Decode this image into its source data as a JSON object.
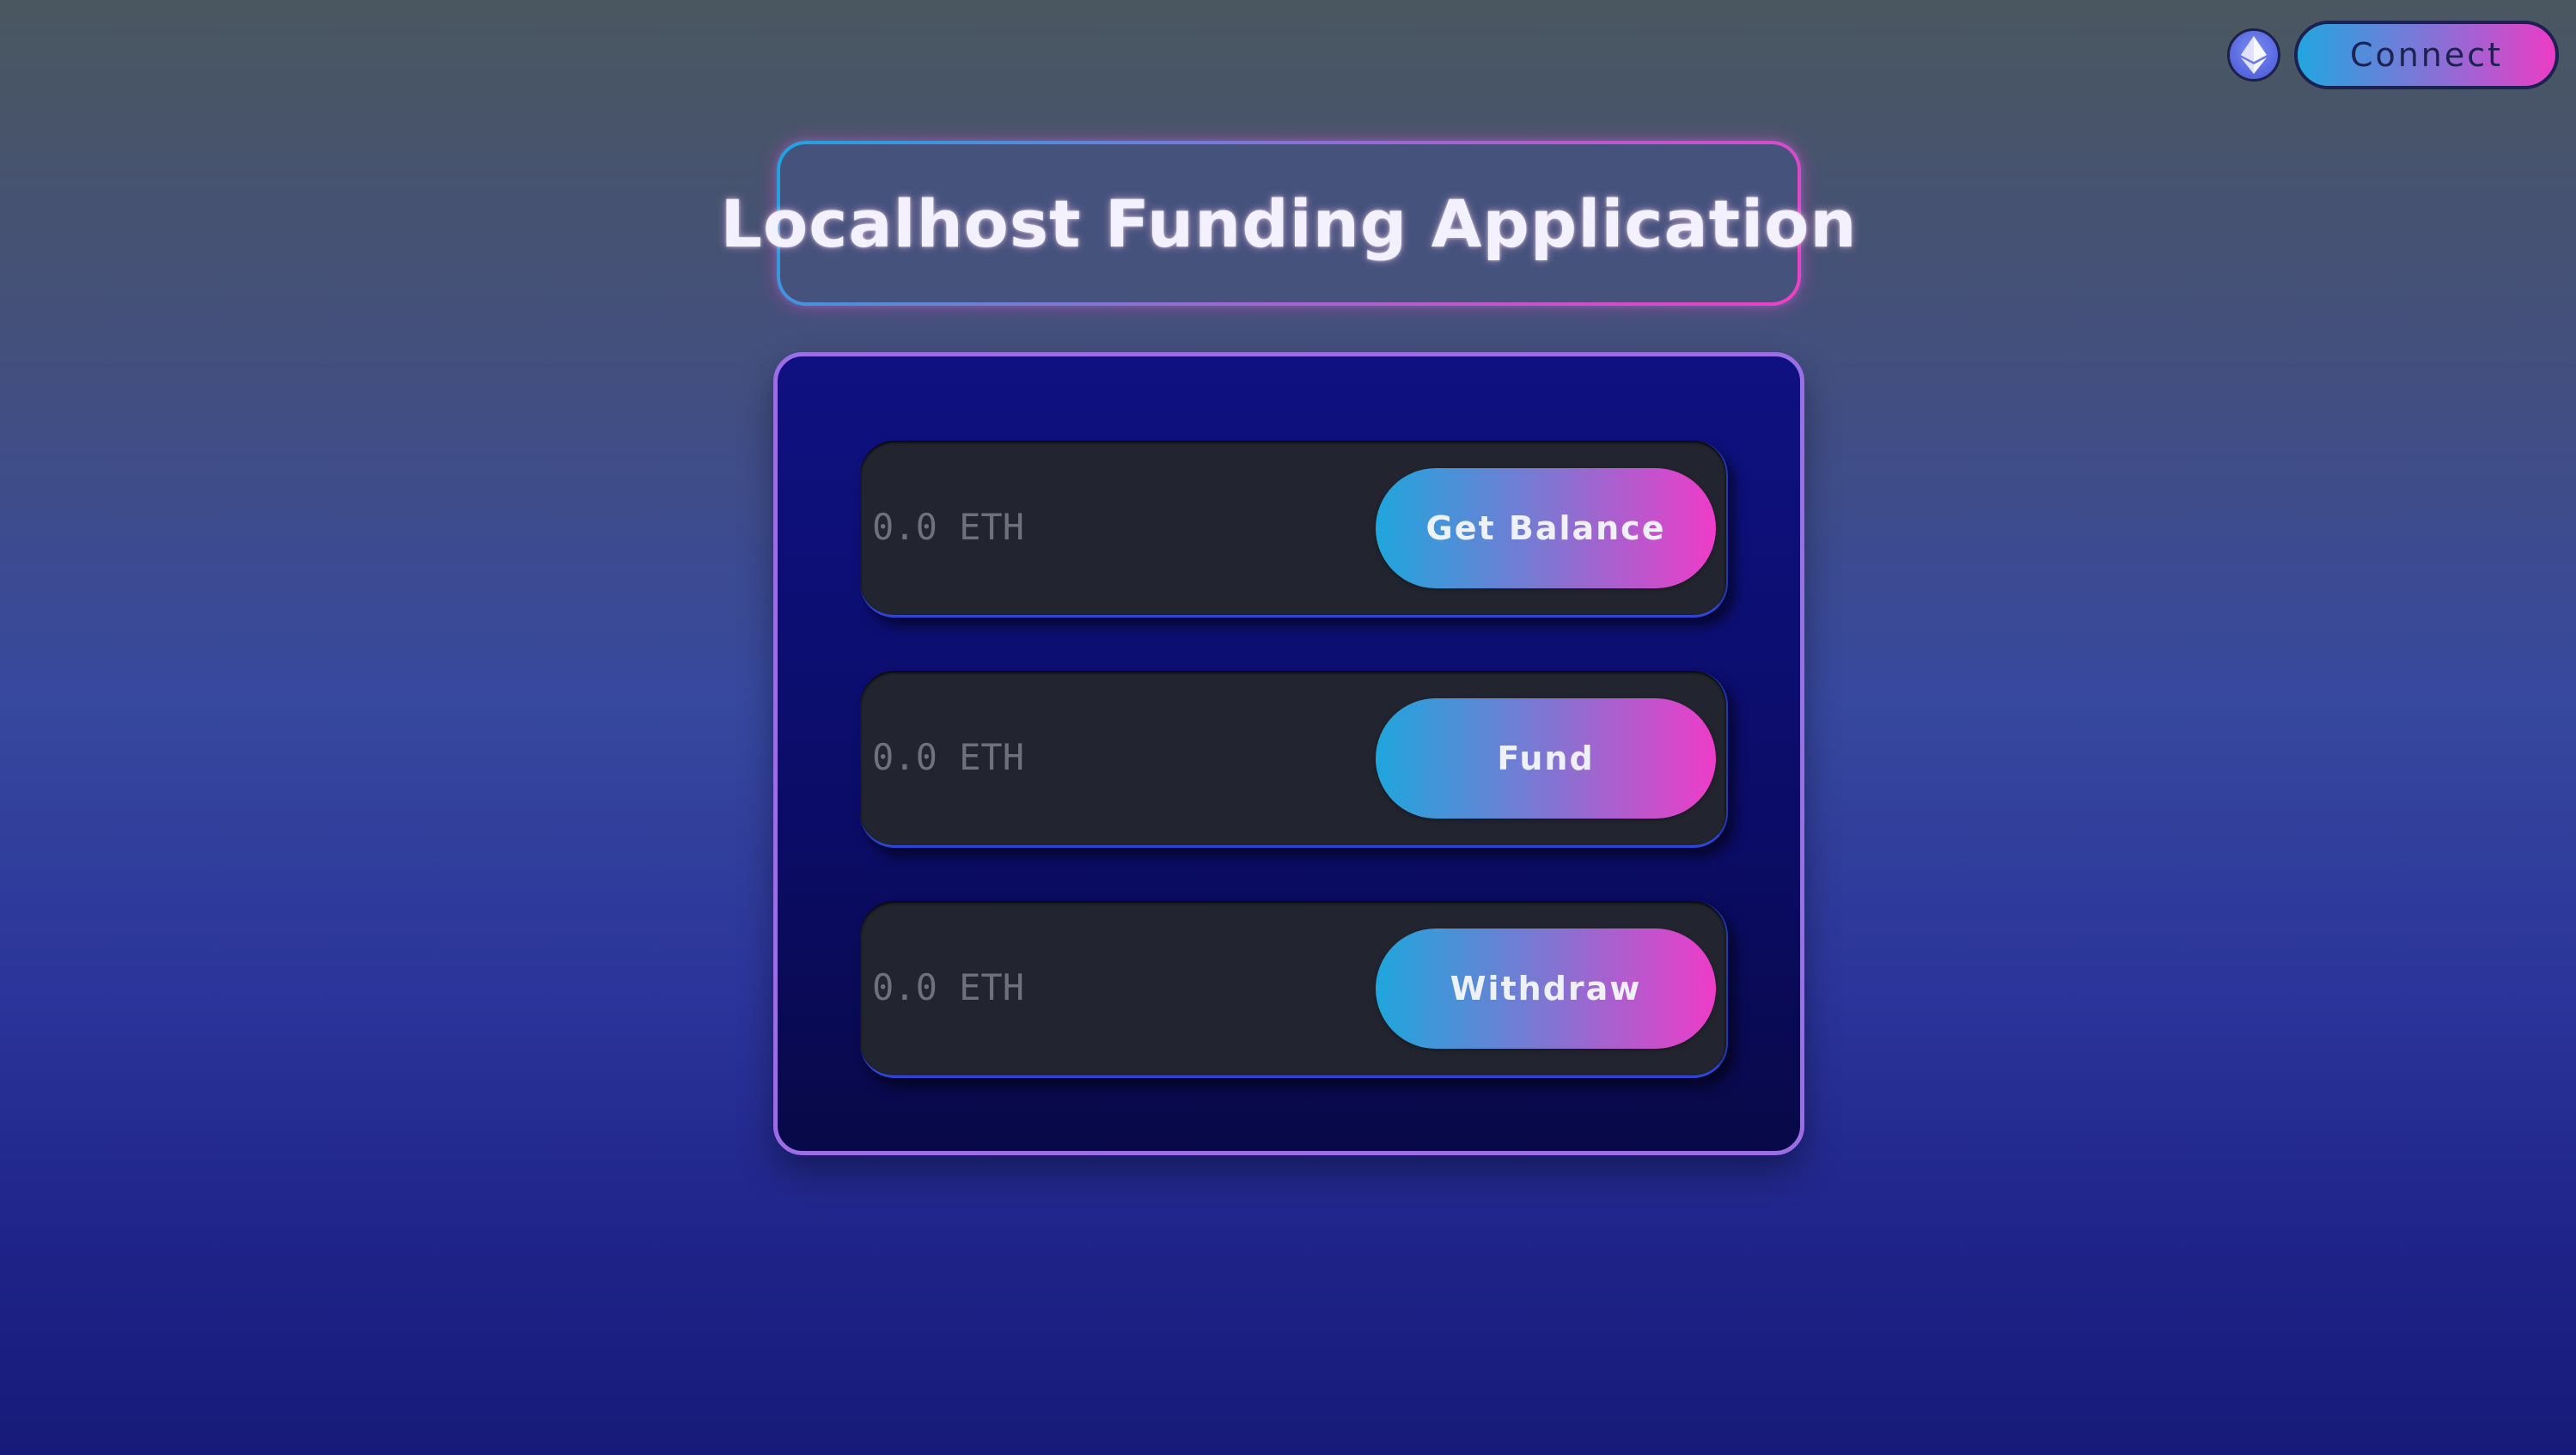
{
  "header": {
    "network_icon": "ethereum-icon",
    "connect_label": "Connect"
  },
  "title": "Localhost Funding Application",
  "panel": {
    "rows": [
      {
        "input_placeholder": "0.0 ETH",
        "button_label": "Get Balance"
      },
      {
        "input_placeholder": "0.0 ETH",
        "button_label": "Fund"
      },
      {
        "input_placeholder": "0.0 ETH",
        "button_label": "Withdraw"
      }
    ]
  },
  "colors": {
    "gradient_start": "#1fa6dc",
    "gradient_end": "#ee3cc8",
    "panel_border": "#9b6ee6",
    "panel_background": "#0f1182",
    "row_background": "#22252f"
  }
}
